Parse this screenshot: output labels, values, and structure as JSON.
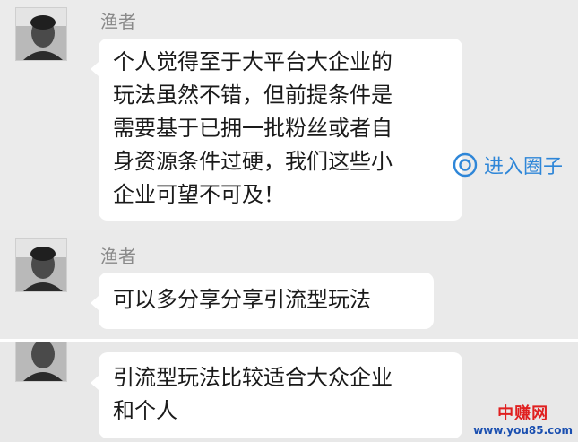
{
  "messages": [
    {
      "sender": "渔者",
      "lines": [
        "个人觉得至于大平台大企业的",
        "玩法虽然不错，但前提条件是",
        "需要基于已拥一批粉丝或者自",
        "身资源条件过硬，我们这些小",
        "企业可望不可及！"
      ]
    },
    {
      "sender": "渔者",
      "lines": [
        "可以多分享分享引流型玩法"
      ]
    },
    {
      "lines": [
        "引流型玩法比较适合大众企业",
        "和个人"
      ]
    }
  ],
  "circle_link": {
    "label": "进入圈子",
    "icon": "ring-icon",
    "color": "#2e86d8"
  },
  "watermark": {
    "logo": "中赚网",
    "url": "www.you85.com"
  }
}
